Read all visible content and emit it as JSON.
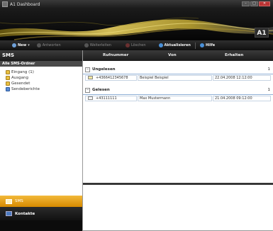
{
  "window": {
    "title": "A1 Dashboard"
  },
  "branding": {
    "logo": "A1"
  },
  "toolbar": {
    "new_label": "New",
    "reply_label": "Antworten",
    "forward_label": "Weiterleiten",
    "delete_label": "Löschen",
    "refresh_label": "Aktualisieren",
    "help_label": "Hilfe"
  },
  "left_panel": {
    "title": "SMS",
    "folder_header": "Alle SMS-Ordner",
    "folders": [
      {
        "label": "Eingang (1)",
        "icon": "inbox-icon"
      },
      {
        "label": "Ausgang",
        "icon": "outbox-icon"
      },
      {
        "label": "Gesendet",
        "icon": "sent-icon"
      },
      {
        "label": "Sendeberichte",
        "icon": "reports-icon"
      }
    ]
  },
  "nav": {
    "sms_label": "SMS",
    "contacts_label": "Kontakte"
  },
  "table": {
    "columns": [
      "Rufnummer",
      "Von",
      "Erhalten"
    ],
    "groups": [
      {
        "label": "Ungelesen",
        "count": "1",
        "rows": [
          {
            "number": "+4366412345678",
            "from": "Beispiel Beispiel",
            "received": "22.04.2008 12:12:00"
          }
        ]
      },
      {
        "label": "Gelesen",
        "count": "1",
        "rows": [
          {
            "number": "+43111111",
            "from": "Max Mustermann",
            "received": "21.04.2008 09:12:00"
          }
        ]
      }
    ]
  },
  "colors": {
    "accent": "#e8a020",
    "header_dark": "#1c1c1c",
    "group_underline": "#8fb0d6"
  }
}
